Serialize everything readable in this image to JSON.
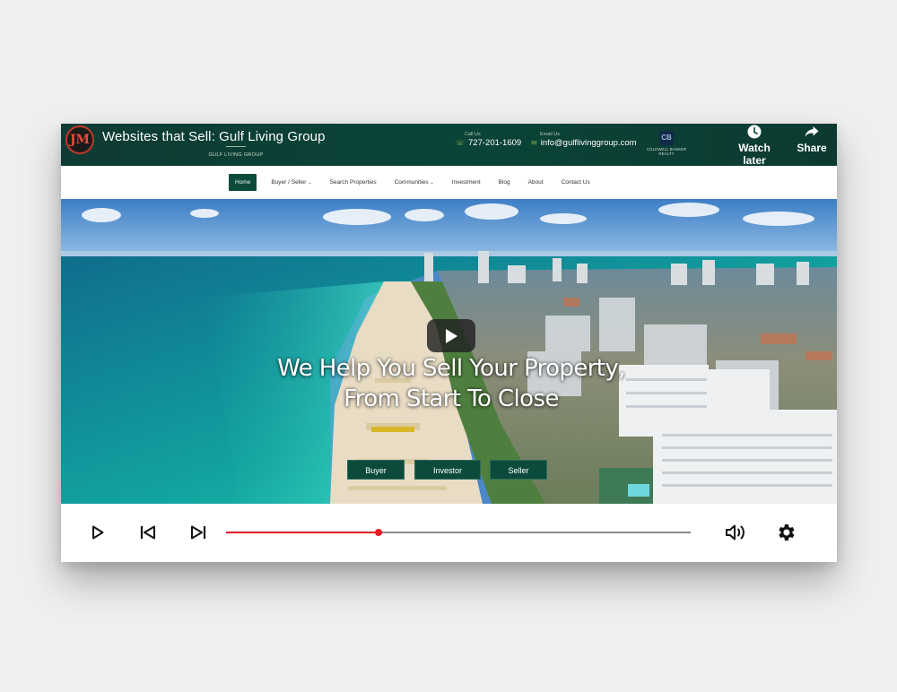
{
  "video": {
    "channel_initials": "JM",
    "title": "Websites that Sell: Gulf Living Group",
    "actions": {
      "watch_later": "Watch later",
      "share": "Share"
    }
  },
  "site": {
    "logo_text": "GULF LIVING GROUP",
    "call": {
      "label": "Call Us",
      "value": "727-201-1609"
    },
    "email": {
      "label": "Email Us",
      "value": "info@gulflivinggroup.com"
    },
    "broker": {
      "mark": "CB",
      "name": "COLDWELL BANKER REALTY"
    },
    "nav": [
      {
        "label": "Home",
        "active": true
      },
      {
        "label": "Buyer / Seller",
        "dropdown": true
      },
      {
        "label": "Search Properties"
      },
      {
        "label": "Communities",
        "dropdown": true
      },
      {
        "label": "Investment"
      },
      {
        "label": "Blog"
      },
      {
        "label": "About"
      },
      {
        "label": "Contact Us"
      }
    ],
    "hero": {
      "headline_line1": "We Help You Sell Your Property,",
      "headline_line2": "From Start To Close",
      "buttons": {
        "buyer": "Buyer",
        "investor": "Investor",
        "seller": "Seller"
      }
    }
  },
  "player": {
    "progress_fraction": 0.328,
    "progress_color": "#e31b23",
    "icons": [
      "play-icon",
      "previous-icon",
      "next-icon",
      "volume-icon",
      "settings-icon"
    ]
  },
  "colors": {
    "brand_green": "#0c4b3b",
    "header_green": "#0a4438"
  }
}
